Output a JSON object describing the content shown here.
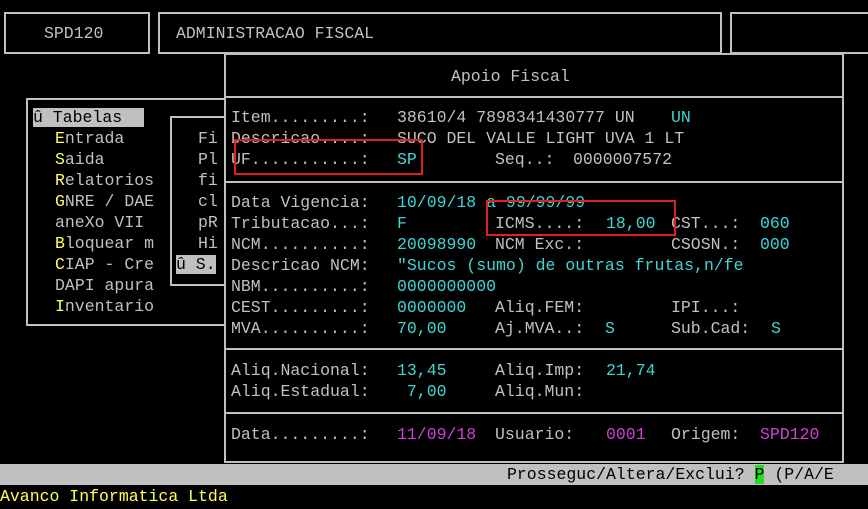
{
  "topbar": {
    "program": "SPD120",
    "title": "ADMINISTRACAO FISCAL"
  },
  "menu": {
    "items": [
      {
        "key": "û",
        "label": " Tabelas"
      },
      {
        "key": "E",
        "label": "ntrada"
      },
      {
        "key": "S",
        "label": "aida"
      },
      {
        "key": "R",
        "label": "elatorios"
      },
      {
        "key": "G",
        "label": "NRE / DAE"
      },
      {
        "key": "ane",
        "label": "Xo VII"
      },
      {
        "key": "B",
        "label": "loquear m"
      },
      {
        "key": "C",
        "label": "IAP - Cre"
      },
      {
        "key": "DA",
        "label": "PI apura"
      },
      {
        "key": "I",
        "label": "nventario"
      }
    ],
    "submenu": [
      "Fi",
      "Pl",
      "fi",
      "cl",
      "pR",
      "Hi",
      "û S."
    ]
  },
  "dialog": {
    "title": "Apoio Fiscal",
    "item_label": "Item.........:",
    "item_value": "38610/4 7898341430777 UN",
    "item_unit": "UN",
    "descricao_label": "Descricao....:",
    "descricao_value": "SUCO DEL VALLE LIGHT UVA 1 LT",
    "uf_label": "UF...........:",
    "uf_value": "SP",
    "seq_label": "Seq..:",
    "seq_value": "0000007572",
    "vigencia_label": "Data Vigencia:",
    "vigencia_value": "10/09/18 a 99/99/99",
    "tributacao_label": "Tributacao...:",
    "tributacao_value": "F",
    "icms_label": "ICMS....:",
    "icms_value": "18,00",
    "cst_label": "CST...:",
    "cst_value": "060",
    "ncm_label": "NCM..........:",
    "ncm_value": "20098990",
    "ncm_exc_label": "NCM Exc.:",
    "csosn_label": "CSOSN.:",
    "csosn_value": "000",
    "desc_ncm_label": "Descricao NCM:",
    "desc_ncm_value": "\"Sucos (sumo) de outras frutas,n/fe",
    "nbm_label": "NBM..........:",
    "nbm_value": "0000000000",
    "cest_label": "CEST.........:",
    "cest_value": "0000000",
    "aliq_fem_label": "Aliq.FEM:",
    "ipi_label": "IPI...:",
    "mva_label": "MVA..........:",
    "mva_value": "70,00",
    "aj_mva_label": "Aj.MVA..:",
    "aj_mva_value": "S",
    "sub_cad_label": "Sub.Cad:",
    "sub_cad_value": "S",
    "aliq_nacional_label": "Aliq.Nacional:",
    "aliq_nacional_value": "13,45",
    "aliq_imp_label": "Aliq.Imp:",
    "aliq_imp_value": "21,74",
    "aliq_estadual_label": "Aliq.Estadual:",
    "aliq_estadual_value": " 7,00",
    "aliq_mun_label": "Aliq.Mun:",
    "data_label": "Data.........:",
    "data_value": "11/09/18",
    "usuario_label": "Usuario:",
    "usuario_value": "0001",
    "origem_label": "Origem:",
    "origem_value": "SPD120"
  },
  "statusbar": {
    "prompt": "Prosseguc/Altera/Exclui?",
    "answer": "P",
    "options": "(P/A/E"
  },
  "footer": {
    "company": "Avanco Informatica Ltda"
  },
  "colors": {
    "accent_box": "#e02020",
    "cyan": "#3fd6d6",
    "magenta": "#d23fd2",
    "cursor": "#22dd22"
  }
}
